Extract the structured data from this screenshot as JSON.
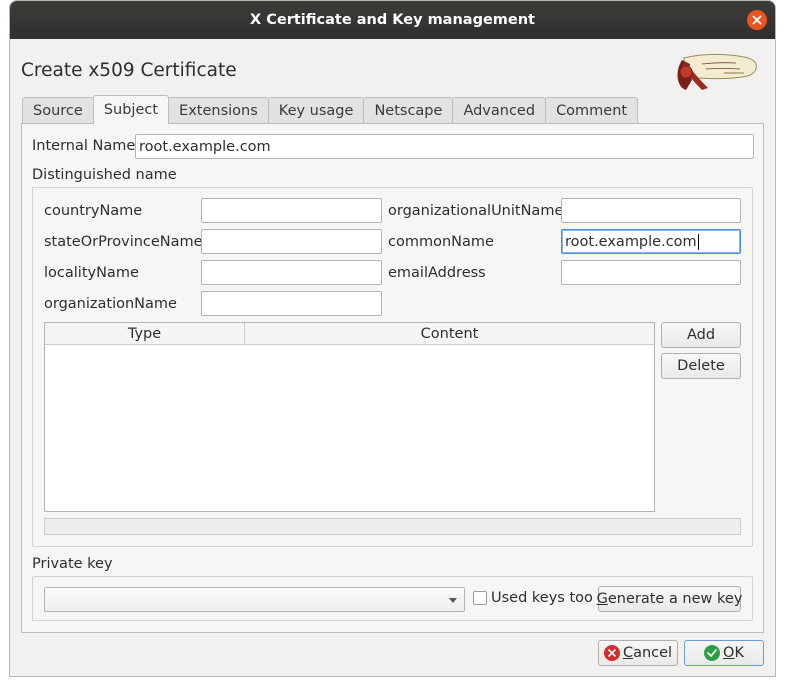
{
  "window": {
    "title": "X Certificate and Key management"
  },
  "dialog": {
    "heading": "Create x509 Certificate"
  },
  "tabs": [
    {
      "label": "Source"
    },
    {
      "label": "Subject"
    },
    {
      "label": "Extensions"
    },
    {
      "label": "Key usage"
    },
    {
      "label": "Netscape"
    },
    {
      "label": "Advanced"
    },
    {
      "label": "Comment"
    }
  ],
  "subject": {
    "internal_name_label": "Internal Name",
    "internal_name_value": "root.example.com",
    "dn_label": "Distinguished name",
    "fields": {
      "country_label": "countryName",
      "country_value": "",
      "state_label": "stateOrProvinceName",
      "state_value": "",
      "locality_label": "localityName",
      "locality_value": "",
      "organization_label": "organizationName",
      "organization_value": "",
      "org_unit_label": "organizationalUnitName",
      "org_unit_value": "",
      "common_name_label": "commonName",
      "common_name_value": "root.example.com",
      "email_label": "emailAddress",
      "email_value": ""
    },
    "table": {
      "columns": [
        "Type",
        "Content"
      ],
      "rows": []
    },
    "add_label": "Add",
    "delete_label": "Delete"
  },
  "private_key": {
    "label": "Private key",
    "selected": "",
    "used_keys_label": "Used keys too",
    "used_keys_checked": false,
    "generate_label": "Generate a new key",
    "generate_mnemonic": "G",
    "generate_rest": "enerate a new key"
  },
  "footer": {
    "cancel_mnemonic": "C",
    "cancel_rest": "ancel",
    "ok_mnemonic": "O",
    "ok_rest": "K"
  },
  "colors": {
    "titlebar": "#302f2d",
    "close": "#e95420",
    "cancel_icon": "#d12c2c",
    "ok_icon": "#2e9e44",
    "focus": "#4a8de0"
  }
}
